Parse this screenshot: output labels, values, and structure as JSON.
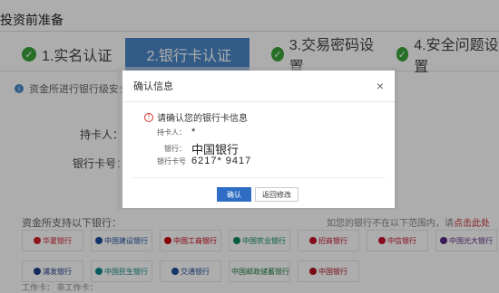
{
  "page": {
    "title": "投资前准备"
  },
  "steps": [
    {
      "label": "1.实名认证",
      "done": true,
      "active": false
    },
    {
      "label": "2.银行卡认证",
      "done": false,
      "active": true
    },
    {
      "label": "3.交易密码设置",
      "done": true,
      "active": false
    },
    {
      "label": "4.安全问题设置",
      "done": true,
      "active": false
    }
  ],
  "notice": {
    "text": "资金所进行银行级安全保障"
  },
  "background_form": {
    "holder_label": "持卡人：",
    "card_label": "银行卡号："
  },
  "banks_section": {
    "heading": "资金所支持以下银行：",
    "right_text": "如您的银行不在以下范围内，请",
    "right_link": "点击此处",
    "banks": [
      {
        "name": "华夏银行",
        "color": "#d2232a"
      },
      {
        "name": "中国建设银行",
        "color": "#1a4b9c"
      },
      {
        "name": "中国工商银行",
        "color": "#c7000b"
      },
      {
        "name": "中国农业银行",
        "color": "#0b8a5a"
      },
      {
        "name": "招商银行",
        "color": "#c8102e"
      },
      {
        "name": "中信银行",
        "color": "#c8102e"
      },
      {
        "name": "中国光大银行",
        "color": "#5b2c83"
      },
      {
        "name": "浦发银行",
        "color": "#1f3f8c"
      },
      {
        "name": "中国民生银行",
        "color": "#118a8a"
      },
      {
        "name": "交通银行",
        "color": "#1f4f9c"
      },
      {
        "name": "中国邮政储蓄银行",
        "color": "#1b7a3e"
      },
      {
        "name": "中国银行",
        "color": "#b0131e"
      }
    ],
    "footer": "工作卡：   非工作卡："
  },
  "dialog": {
    "title": "确认信息",
    "close": "×",
    "alert_text": "请确认您的银行卡信息",
    "holder_label": "持卡人：",
    "holder_value": "*",
    "bank_label": "银行：",
    "bank_value": "中国银行",
    "card_label": "银行卡号",
    "card_value": "6217*        9417",
    "confirm_label": "确认",
    "back_label": "返回修改"
  }
}
